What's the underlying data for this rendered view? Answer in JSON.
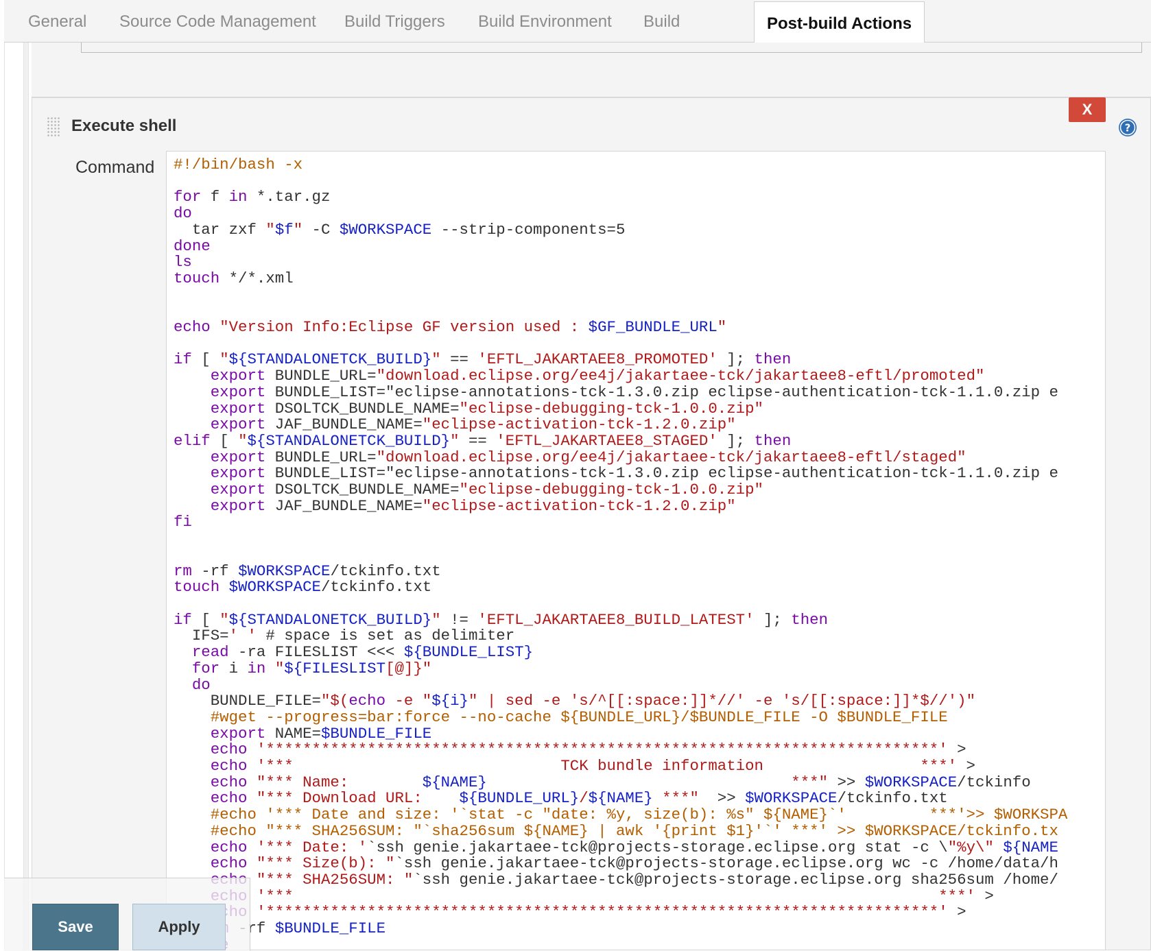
{
  "tabs": [
    {
      "label": "General"
    },
    {
      "label": "Source Code Management"
    },
    {
      "label": "Build Triggers"
    },
    {
      "label": "Build Environment"
    },
    {
      "label": "Build"
    },
    {
      "label": "Post-build Actions",
      "active": true
    }
  ],
  "section": {
    "title": "Execute shell",
    "delete_label": "X",
    "command_label": "Command"
  },
  "command": {
    "lines": [
      "#!/bin/bash -x",
      "",
      "for f in *.tar.gz",
      "do",
      "  tar zxf \"$f\" -C $WORKSPACE --strip-components=5",
      "done",
      "ls",
      "touch */*.xml",
      "",
      "",
      "echo \"Version Info:Eclipse GF version used : $GF_BUNDLE_URL\"",
      "",
      "if [ \"${STANDALONETCK_BUILD}\" == 'EFTL_JAKARTAEE8_PROMOTED' ]; then",
      "    export BUNDLE_URL=\"download.eclipse.org/ee4j/jakartaee-tck/jakartaee8-eftl/promoted\"",
      "    export BUNDLE_LIST=\"eclipse-annotations-tck-1.3.0.zip eclipse-authentication-tck-1.1.0.zip e",
      "    export DSOLTCK_BUNDLE_NAME=\"eclipse-debugging-tck-1.0.0.zip\"",
      "    export JAF_BUNDLE_NAME=\"eclipse-activation-tck-1.2.0.zip\"",
      "elif [ \"${STANDALONETCK_BUILD}\" == 'EFTL_JAKARTAEE8_STAGED' ]; then",
      "    export BUNDLE_URL=\"download.eclipse.org/ee4j/jakartaee-tck/jakartaee8-eftl/staged\"",
      "    export BUNDLE_LIST=\"eclipse-annotations-tck-1.3.0.zip eclipse-authentication-tck-1.1.0.zip e",
      "    export DSOLTCK_BUNDLE_NAME=\"eclipse-debugging-tck-1.0.0.zip\"",
      "    export JAF_BUNDLE_NAME=\"eclipse-activation-tck-1.2.0.zip\"",
      "fi",
      "",
      "",
      "rm -rf $WORKSPACE/tckinfo.txt",
      "touch $WORKSPACE/tckinfo.txt",
      "",
      "if [ \"${STANDALONETCK_BUILD}\" != 'EFTL_JAKARTAEE8_BUILD_LATEST' ]; then",
      "  IFS=' ' # space is set as delimiter",
      "  read -ra FILESLIST <<< ${BUNDLE_LIST}",
      "  for i in \"${FILESLIST[@]}\"",
      "  do",
      "    BUNDLE_FILE=\"$(echo -e \"${i}\" | sed -e 's/^[[:space:]]*//' -e 's/[[:space:]]*$//')\"",
      "    #wget --progress=bar:force --no-cache ${BUNDLE_URL}/$BUNDLE_FILE -O $BUNDLE_FILE",
      "    export NAME=$BUNDLE_FILE",
      "    echo '*************************************************************************' >",
      "    echo '***                             TCK bundle information                 ***' >",
      "    echo \"*** Name:        ${NAME}                                 ***\" >> $WORKSPACE/tckinfo",
      "    echo \"*** Download URL:    ${BUNDLE_URL}/${NAME} ***\"  >> $WORKSPACE/tckinfo.txt",
      "    #echo '*** Date and size: '`stat -c \"date: %y, size(b): %s\" ${NAME}`'         ***'>> $WORKSPA",
      "    #echo \"*** SHA256SUM: \"`sha256sum ${NAME} | awk '{print $1}'`' ***' >> $WORKSPACE/tckinfo.tx",
      "    echo '*** Date: '`ssh genie.jakartaee-tck@projects-storage.eclipse.org stat -c \\\"%y\\\" ${NAME",
      "    echo \"*** Size(b): \"`ssh genie.jakartaee-tck@projects-storage.eclipse.org wc -c /home/data/h",
      "    echo \"*** SHA256SUM: \"`ssh genie.jakartaee-tck@projects-storage.eclipse.org sha256sum /home/",
      "    echo '***                                                                      ***' >",
      "    echo '*************************************************************************' >",
      "    rm -rf $BUNDLE_FILE",
      "  done"
    ]
  },
  "buttons": {
    "save": "Save",
    "apply": "Apply"
  },
  "icons": {
    "help": "help-circle-icon",
    "drag": "drag-handle-icon"
  },
  "colors": {
    "accent": "#4b758b",
    "delete": "#d24939",
    "help": "#2f6db5"
  }
}
